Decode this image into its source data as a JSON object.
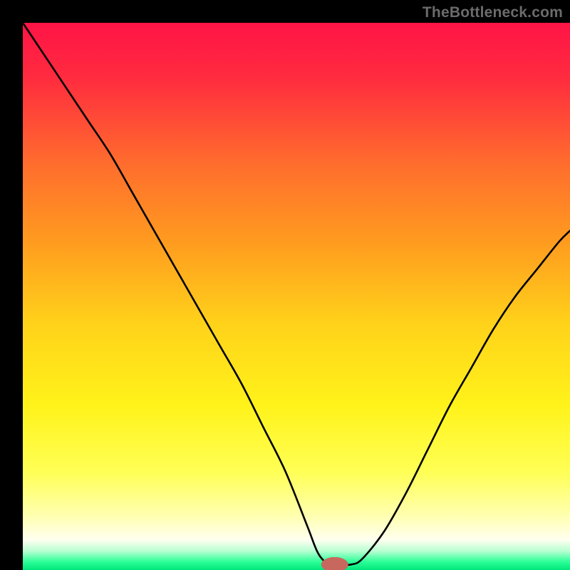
{
  "attribution": "TheBottleneck.com",
  "colors": {
    "frame": "#000000",
    "gradient_stops": [
      {
        "offset": 0.0,
        "color": "#ff1446"
      },
      {
        "offset": 0.1,
        "color": "#ff2b3f"
      },
      {
        "offset": 0.25,
        "color": "#ff6a2e"
      },
      {
        "offset": 0.4,
        "color": "#ff9b1f"
      },
      {
        "offset": 0.55,
        "color": "#ffd21a"
      },
      {
        "offset": 0.7,
        "color": "#fff31a"
      },
      {
        "offset": 0.82,
        "color": "#ffff55"
      },
      {
        "offset": 0.9,
        "color": "#ffffaf"
      },
      {
        "offset": 0.945,
        "color": "#fffff0"
      },
      {
        "offset": 0.965,
        "color": "#b9ffd2"
      },
      {
        "offset": 0.985,
        "color": "#2cff98"
      },
      {
        "offset": 1.0,
        "color": "#00e67b"
      }
    ],
    "curve": "#000000",
    "marker_fill": "#c8675e",
    "marker_stroke": "#c8675e"
  },
  "chart_data": {
    "type": "line",
    "title": "",
    "xlabel": "",
    "ylabel": "",
    "xlim": [
      0,
      100
    ],
    "ylim": [
      0,
      100
    ],
    "series": [
      {
        "name": "bottleneck-curve",
        "x": [
          0,
          4,
          8,
          12,
          16,
          20,
          24,
          28,
          32,
          36,
          40,
          44,
          48,
          52,
          54,
          56,
          58,
          60,
          62,
          66,
          70,
          74,
          78,
          82,
          86,
          90,
          94,
          98,
          100
        ],
        "y": [
          100,
          94,
          88,
          82,
          76,
          69,
          62,
          55,
          48,
          41,
          34,
          26,
          18,
          8,
          3,
          1,
          1,
          1,
          2,
          7,
          14,
          22,
          30,
          37,
          44,
          50,
          55,
          60,
          62
        ]
      }
    ],
    "flat_bottom": {
      "x_start": 53,
      "x_end": 60,
      "y": 1
    },
    "marker": {
      "x": 57,
      "y": 1,
      "rx": 2.4,
      "ry": 1.3
    }
  }
}
